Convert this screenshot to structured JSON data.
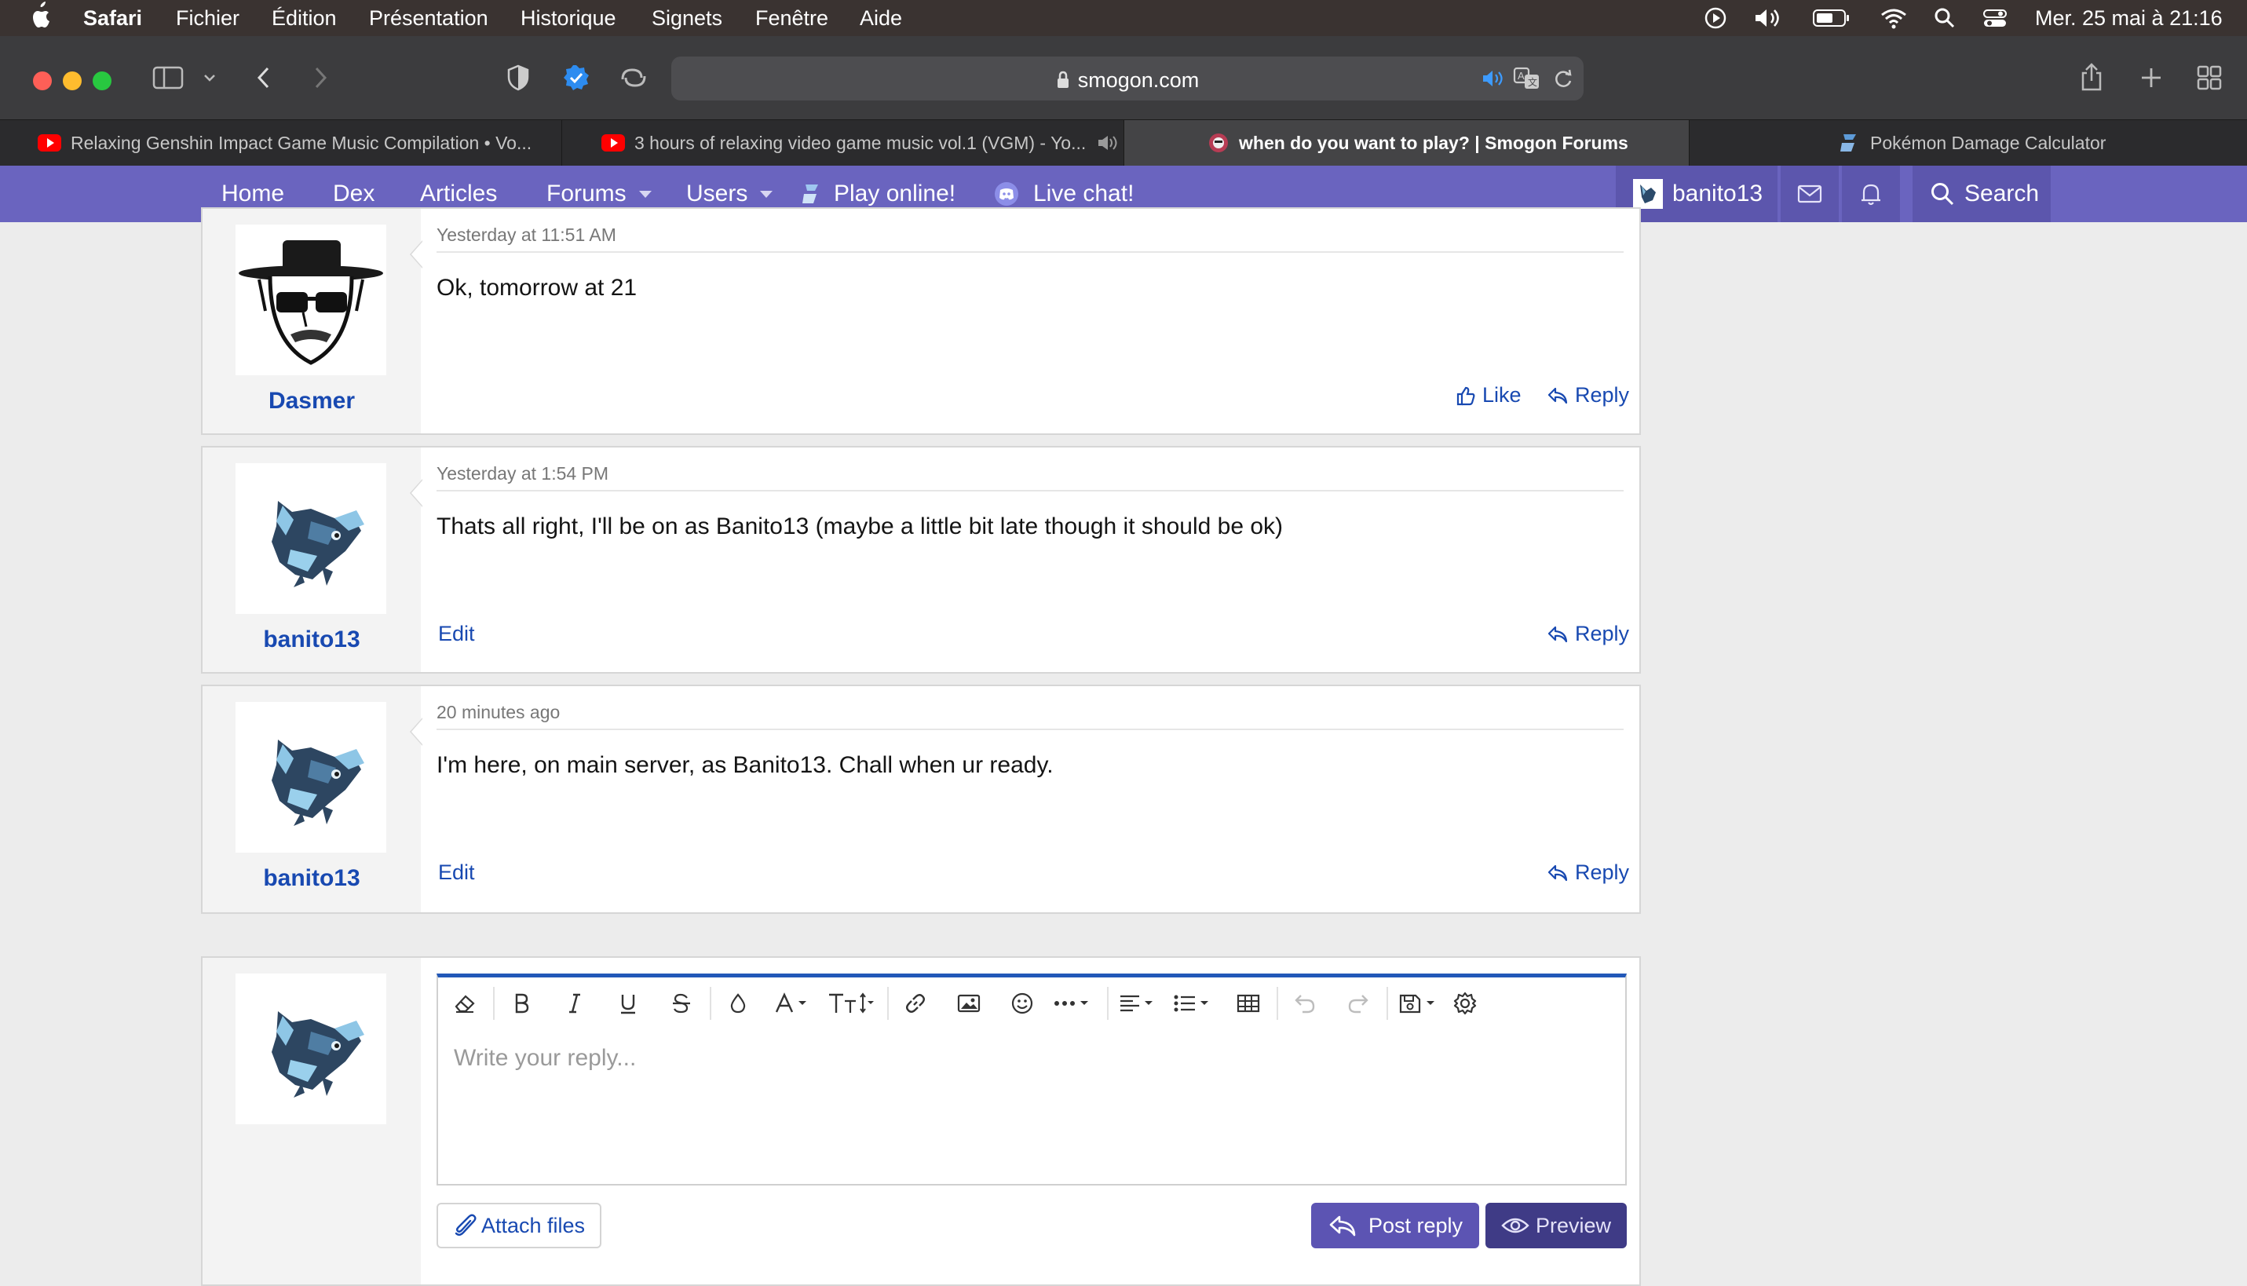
{
  "colors": {
    "menubar": "#3a3331",
    "toolbar": "#3c3c3e",
    "site_nav": "#6a64bf",
    "link": "#1849b1",
    "post_button": "#5c54b3",
    "preview_button": "#3f3b86",
    "editor_accent": "#2258b8"
  },
  "menubar": {
    "apple_icon": "apple-logo-icon",
    "app_name": "Safari",
    "items": [
      "Fichier",
      "Édition",
      "Présentation",
      "Historique",
      "Signets",
      "Fenêtre",
      "Aide"
    ],
    "clock": "Mer. 25 mai à  21:16",
    "status_icons": [
      "play-circle-icon",
      "volume-icon",
      "battery-icon",
      "wifi-icon",
      "spotlight-search-icon",
      "control-center-icon"
    ]
  },
  "toolbar": {
    "url": "smogon.com",
    "icons": [
      "sidebar-icon",
      "chevron-down-icon",
      "back-icon",
      "forward-icon",
      "privacy-shield-icon",
      "extension-check-icon",
      "extension-icon",
      "lock-icon",
      "audio-icon",
      "translate-icon",
      "reload-icon",
      "share-icon",
      "new-tab-icon",
      "tab-overview-icon"
    ]
  },
  "tabs": [
    {
      "title": "Relaxing Genshin Impact Game Music Compilation • Vo...",
      "icon": "youtube-icon",
      "active": false
    },
    {
      "title": "3 hours of relaxing video game music vol.1 (VGM) - Yo...",
      "icon": "youtube-icon",
      "active": false
    },
    {
      "title": "when do you want to play? | Smogon Forums",
      "icon": "smogon-icon",
      "active": true
    },
    {
      "title": "Pokémon Damage Calculator",
      "icon": "showdown-icon",
      "active": false
    }
  ],
  "nav": {
    "items": [
      "Home",
      "Dex",
      "Articles",
      "Forums",
      "Users",
      "Play online!",
      "Live chat!"
    ],
    "user": "banito13",
    "search": "Search"
  },
  "posts": [
    {
      "author": "Dasmer",
      "date": "Yesterday at 11:51 AM",
      "message": "Ok, tomorrow at 21",
      "like": "Like",
      "reply": "Reply"
    },
    {
      "author": "banito13",
      "date": "Yesterday at 1:54 PM",
      "message": "Thats all right, I'll be on as Banito13 (maybe a little bit late though it should be ok)",
      "edit": "Edit",
      "reply": "Reply"
    },
    {
      "author": "banito13",
      "date": "20 minutes ago",
      "message": "I'm here, on main server, as Banito13. Chall when ur ready.",
      "edit": "Edit",
      "reply": "Reply"
    }
  ],
  "editor": {
    "placeholder": "Write your reply...",
    "tools": [
      "eraser-icon",
      "bold-icon",
      "italic-icon",
      "underline-icon",
      "strikethrough-icon",
      "color-drop-icon",
      "font-family-icon",
      "font-size-icon",
      "link-icon",
      "image-icon",
      "emoji-icon",
      "more-icon",
      "align-icon",
      "list-icon",
      "table-icon",
      "undo-icon",
      "redo-icon",
      "save-draft-icon",
      "settings-gear-icon"
    ],
    "attach": "Attach files",
    "post": "Post reply",
    "preview": "Preview"
  }
}
